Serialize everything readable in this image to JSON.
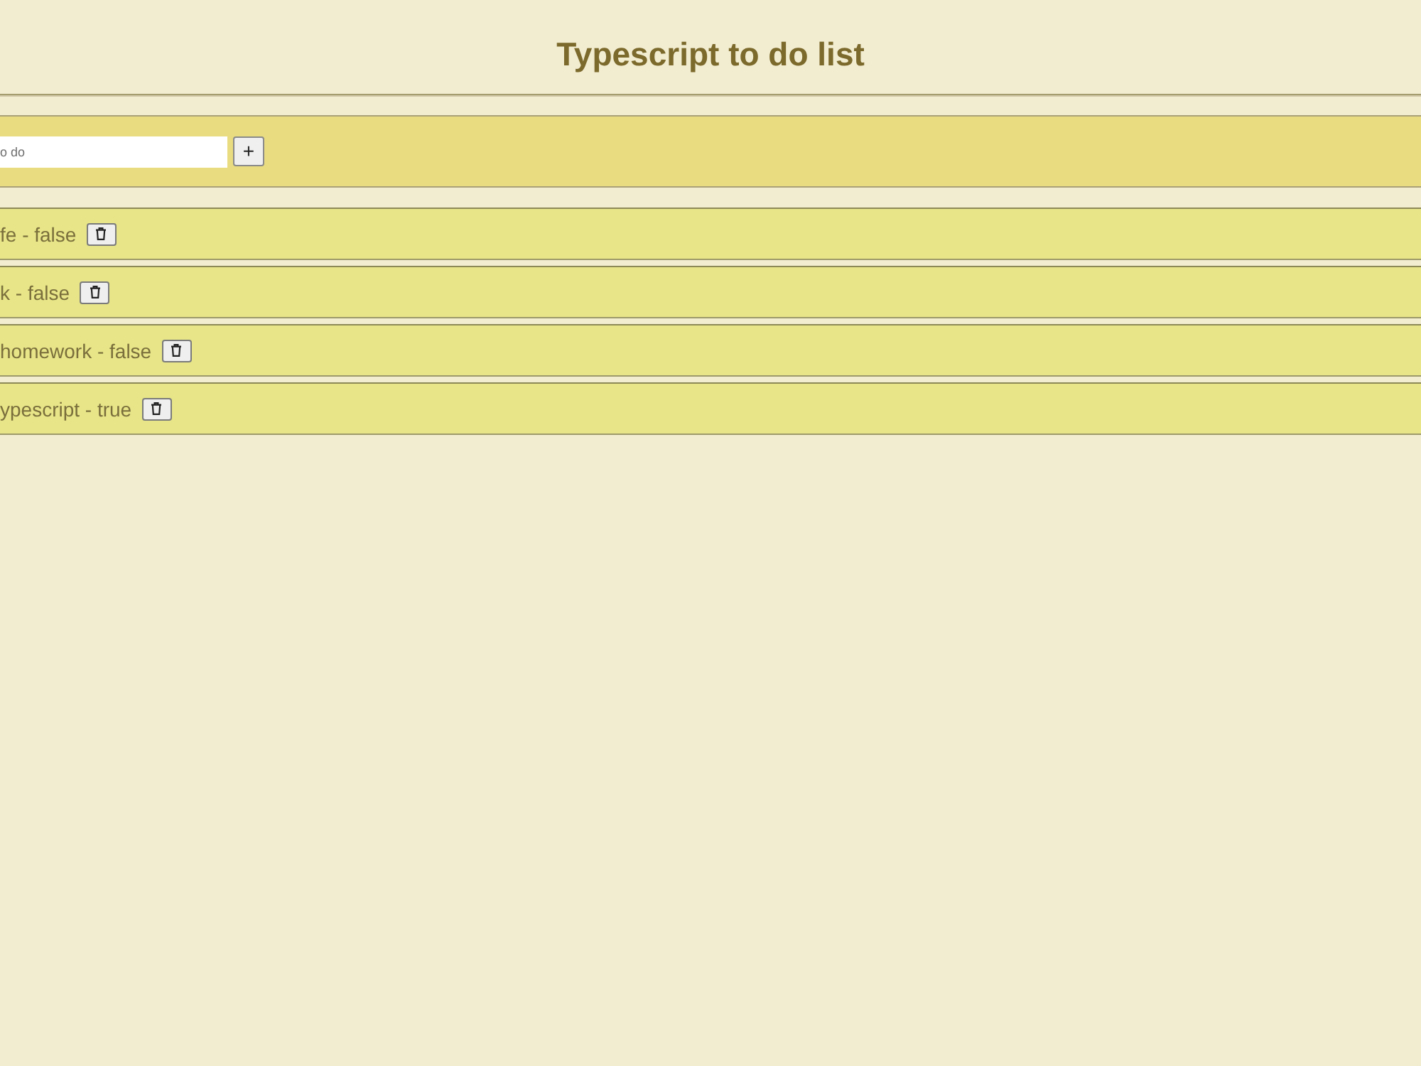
{
  "title": "Typescript to do list",
  "new_todo": {
    "placeholder": "o do",
    "add_label": "+"
  },
  "todos": [
    {
      "text": "fe - false"
    },
    {
      "text": "k - false"
    },
    {
      "text": "homework - false"
    },
    {
      "text": "ypescript - true"
    }
  ]
}
